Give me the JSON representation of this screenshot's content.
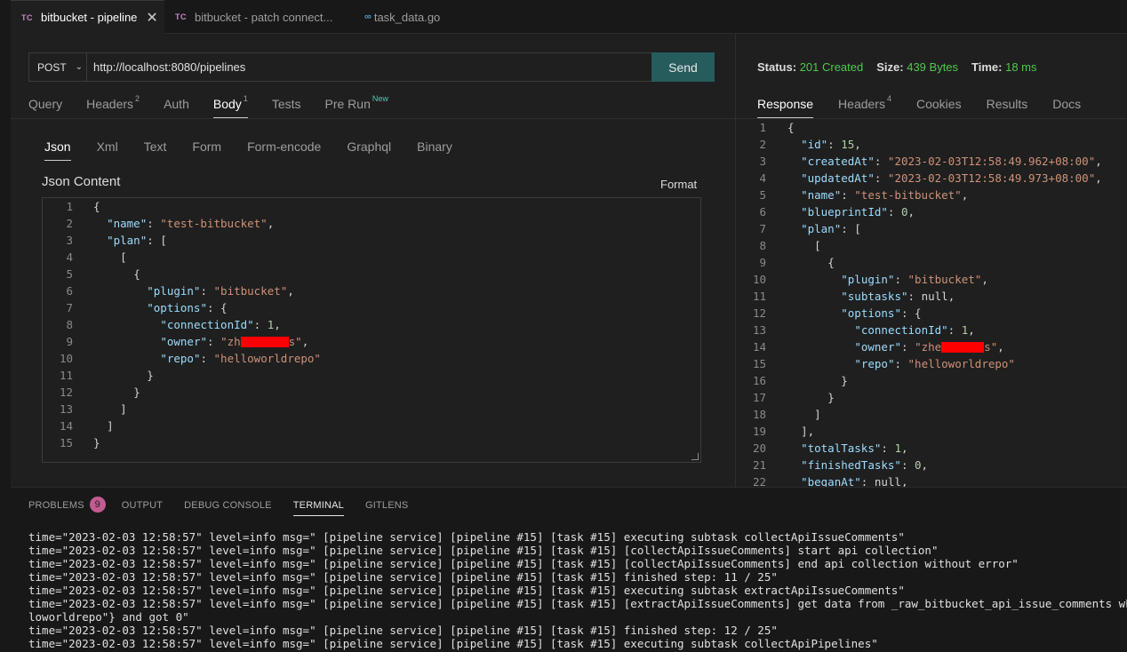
{
  "tabs": [
    {
      "badge": "TC",
      "label": "bitbucket - pipeline",
      "close": "✕"
    },
    {
      "badge": "TC",
      "label": "bitbucket - patch connect..."
    },
    {
      "badge": "GO",
      "label": "task_data.go"
    }
  ],
  "request": {
    "method": "POST",
    "url": "http://localhost:8080/pipelines",
    "send_label": "Send",
    "tabs": [
      {
        "label": "Query"
      },
      {
        "label": "Headers",
        "sup": "2"
      },
      {
        "label": "Auth"
      },
      {
        "label": "Body",
        "sup": "1"
      },
      {
        "label": "Tests"
      },
      {
        "label": "Pre Run",
        "sup": "New"
      }
    ],
    "body_tabs": [
      "Json",
      "Xml",
      "Text",
      "Form",
      "Form-encode",
      "Graphql",
      "Binary"
    ],
    "json_content_label": "Json Content",
    "format_label": "Format",
    "body_lines": [
      "{",
      "  \"name\": \"test-bitbucket\",",
      "  \"plan\": [",
      "    [",
      "      {",
      "        \"plugin\": \"bitbucket\",",
      "        \"options\": {",
      "          \"connectionId\": 1,",
      "          \"owner\": \"zh",
      "          \"repo\": \"helloworldrepo\"",
      "        }",
      "      }",
      "    ]",
      "  ]",
      "}"
    ],
    "owner_suffix": "s\","
  },
  "response": {
    "status_label": "Status:",
    "status_value": "201 Created",
    "size_label": "Size:",
    "size_value": "439 Bytes",
    "time_label": "Time:",
    "time_value": "18 ms",
    "tabs": [
      {
        "label": "Response"
      },
      {
        "label": "Headers",
        "sup": "4"
      },
      {
        "label": "Cookies"
      },
      {
        "label": "Results"
      },
      {
        "label": "Docs"
      }
    ],
    "lines": [
      "{",
      "  \"id\": 15,",
      "  \"createdAt\": \"2023-02-03T12:58:49.962+08:00\",",
      "  \"updatedAt\": \"2023-02-03T12:58:49.973+08:00\",",
      "  \"name\": \"test-bitbucket\",",
      "  \"blueprintId\": 0,",
      "  \"plan\": [",
      "    [",
      "      {",
      "        \"plugin\": \"bitbucket\",",
      "        \"subtasks\": null,",
      "        \"options\": {",
      "          \"connectionId\": 1,",
      "          \"owner\": \"zhe",
      "          \"repo\": \"helloworldrepo\"",
      "        }",
      "      }",
      "    ]",
      "  ],",
      "  \"totalTasks\": 1,",
      "  \"finishedTasks\": 0,",
      "  \"beganAt\": null,"
    ],
    "owner_suffix": "s\","
  },
  "panel": {
    "tabs": [
      "PROBLEMS",
      "OUTPUT",
      "DEBUG CONSOLE",
      "TERMINAL",
      "GITLENS"
    ],
    "problems_count": "9",
    "terminal_lines": [
      "time=\"2023-02-03 12:58:57\" level=info msg=\" [pipeline service] [pipeline #15] [task #15] executing subtask collectApiIssueComments\"",
      "time=\"2023-02-03 12:58:57\" level=info msg=\" [pipeline service] [pipeline #15] [task #15] [collectApiIssueComments] start api collection\"",
      "time=\"2023-02-03 12:58:57\" level=info msg=\" [pipeline service] [pipeline #15] [task #15] [collectApiIssueComments] end api collection without error\"",
      "time=\"2023-02-03 12:58:57\" level=info msg=\" [pipeline service] [pipeline #15] [task #15] finished step: 11 / 25\"",
      "time=\"2023-02-03 12:58:57\" level=info msg=\" [pipeline service] [pipeline #15] [task #15] executing subtask extractApiIssueComments\"",
      "time=\"2023-02-03 12:58:57\" level=info msg=\" [pipeline service] [pipeline #15] [task #15] [extractApiIssueComments] get data from _raw_bitbucket_api_issue_comments where params={",
      "loworldrepo\"} and got 0\"",
      "time=\"2023-02-03 12:58:57\" level=info msg=\" [pipeline service] [pipeline #15] [task #15] finished step: 12 / 25\"",
      "time=\"2023-02-03 12:58:57\" level=info msg=\" [pipeline service] [pipeline #15] [task #15] executing subtask collectApiPipelines\""
    ]
  }
}
